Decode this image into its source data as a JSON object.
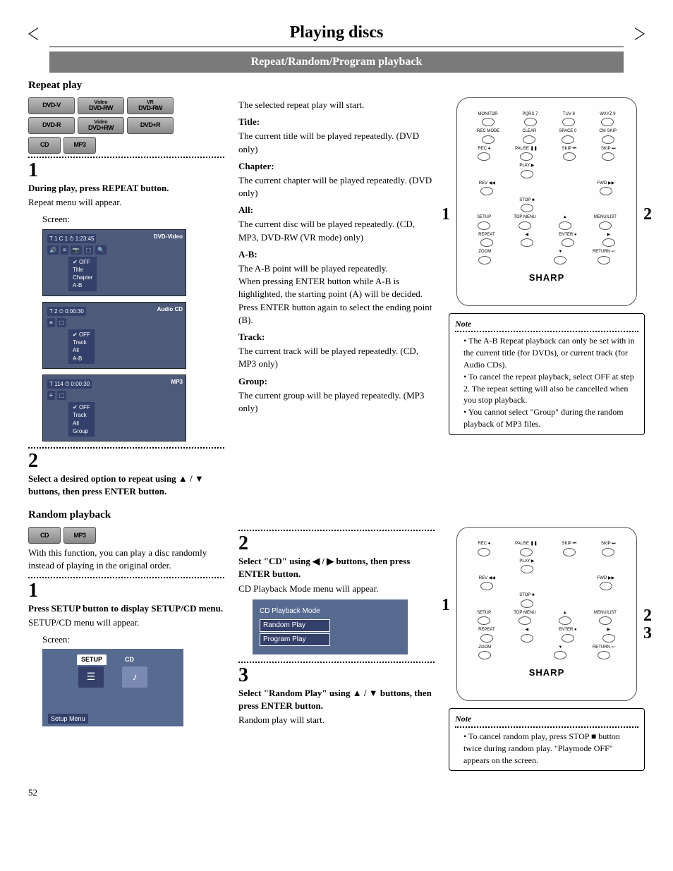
{
  "page_title": "Playing discs",
  "sub_banner": "Repeat/Random/Program playback",
  "page_number": "52",
  "repeat": {
    "heading": "Repeat play",
    "badges": [
      {
        "top": "",
        "bot": "DVD-V"
      },
      {
        "top": "Video",
        "bot": "DVD-RW"
      },
      {
        "top": "VR",
        "bot": "DVD-RW"
      },
      {
        "top": "",
        "bot": "DVD-R"
      },
      {
        "top": "Video",
        "bot": "DVD+RW"
      },
      {
        "top": "",
        "bot": "DVD+R"
      },
      {
        "top": "",
        "bot": "CD"
      },
      {
        "top": "",
        "bot": "MP3"
      }
    ],
    "step1_num": "1",
    "step1_label": "During play, press REPEAT button.",
    "step1_text": "Repeat menu will appear.",
    "screen_label": "Screen:",
    "osd1": {
      "tag": "DVD-Video",
      "top": "T   1 C   1 ⏱   1:23:45",
      "menu": [
        "OFF",
        "Title",
        "Chapter",
        "A-B"
      ]
    },
    "osd2": {
      "tag": "Audio CD",
      "top": "T   2 ⏱   0:00:30",
      "menu": [
        "OFF",
        "Track",
        "All",
        "A-B"
      ]
    },
    "osd3": {
      "tag": "MP3",
      "top": "T 114 ⏱   0:00:30",
      "menu": [
        "OFF",
        "Track",
        "All",
        "Group"
      ]
    },
    "step2_num": "2",
    "step2_label": "Select a desired option to repeat using ▲ / ▼ buttons, then press ENTER button.",
    "col2_intro": "The selected repeat play will start.",
    "terms": [
      {
        "h": "Title:",
        "t": "The current title will be played repeatedly. (DVD only)"
      },
      {
        "h": "Chapter:",
        "t": "The current chapter will be played repeatedly. (DVD only)"
      },
      {
        "h": "All:",
        "t": "The current disc will be played repeatedly. (CD, MP3, DVD-RW (VR mode) only)"
      },
      {
        "h": "A-B:",
        "t": "The A-B point will be played repeatedly.\nWhen pressing ENTER button while A-B is highlighted, the starting point (A) will be decided. Press ENTER button again to select the ending point (B)."
      },
      {
        "h": "Track:",
        "t": "The current track will be played repeatedly. (CD, MP3 only)"
      },
      {
        "h": "Group:",
        "t": "The current group will be played repeatedly. (MP3 only)"
      }
    ],
    "remote_logo": "SHARP",
    "remote_rows": [
      [
        "MONITOR",
        "PQRS 7",
        "TUV 8",
        "WXYZ 9"
      ],
      [
        "REC MODE",
        "CLEAR",
        "SPACE 0",
        "CM SKIP"
      ],
      [
        "REC ●",
        "PAUSE ❚❚",
        "SKIP ⏮",
        "SKIP ⏭"
      ],
      [
        "",
        "PLAY ▶",
        "",
        ""
      ],
      [
        "REV ◀◀",
        "",
        "",
        "FWD ▶▶"
      ],
      [
        "",
        "STOP ■",
        "",
        ""
      ],
      [
        "SETUP",
        "TOP MENU",
        "▲",
        "MENU/LIST"
      ],
      [
        "REPEAT",
        "◀",
        "ENTER ●",
        "▶"
      ],
      [
        "ZOOM",
        "",
        "▼",
        "RETURN ↩"
      ]
    ],
    "call1": "1",
    "call2": "2",
    "note": {
      "title": "Note",
      "items": [
        "The A-B Repeat playback can only be set with in the current title (for DVDs), or current track (for Audio CDs).",
        "To cancel the repeat playback, select OFF at step 2. The repeat setting will also be cancelled when you stop playback.",
        "You cannot select \"Group\" during the random playback of MP3 files."
      ]
    }
  },
  "random": {
    "heading": "Random playback",
    "badges": [
      {
        "top": "",
        "bot": "CD"
      },
      {
        "top": "",
        "bot": "MP3"
      }
    ],
    "intro": "With this function, you can play a disc randomly instead of playing in the original order.",
    "step1_num": "1",
    "step1_label": "Press SETUP button to display SETUP/CD menu.",
    "step1_text": "SETUP/CD menu will appear.",
    "screen_label": "Screen:",
    "setup_tab1": "SETUP",
    "setup_tab2": "CD",
    "setup_caption": "Setup Menu",
    "step2_num": "2",
    "step2_label": "Select \"CD\" using ◀ / ▶ buttons, then press ENTER button.",
    "step2_text": "CD Playback Mode menu will appear.",
    "cdmenu_head": "CD Playback Mode",
    "cdmenu_opts": [
      "Random Play",
      "Program Play"
    ],
    "step3_num": "3",
    "step3_label": "Select \"Random Play\" using ▲ / ▼ buttons, then press ENTER button.",
    "step3_text": "Random play will start.",
    "remote_logo": "SHARP",
    "remote_rows": [
      [
        "REC ●",
        "PAUSE ❚❚",
        "SKIP ⏮",
        "SKIP ⏭"
      ],
      [
        "",
        "PLAY ▶",
        "",
        ""
      ],
      [
        "REV ◀◀",
        "",
        "",
        "FWD ▶▶"
      ],
      [
        "",
        "STOP ■",
        "",
        ""
      ],
      [
        "SETUP",
        "TOP MENU",
        "▲",
        "MENU/LIST"
      ],
      [
        "REPEAT",
        "◀",
        "ENTER ●",
        "▶"
      ],
      [
        "ZOOM",
        "",
        "▼",
        "RETURN ↩"
      ]
    ],
    "call1": "1",
    "call2": "2",
    "call3": "3",
    "note": {
      "title": "Note",
      "items": [
        "To cancel random play, press STOP ■ button twice during random play. \"Playmode OFF\" appears on the screen."
      ]
    }
  }
}
